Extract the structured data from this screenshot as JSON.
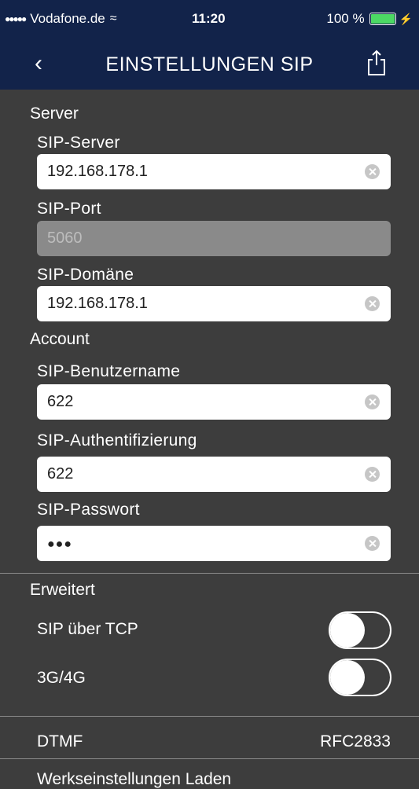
{
  "status_bar": {
    "carrier": "Vodafone.de",
    "time": "11:20",
    "battery": "100 %"
  },
  "nav": {
    "title": "EINSTELLUNGEN SIP"
  },
  "server": {
    "section": "Server",
    "sip_server_label": "SIP-Server",
    "sip_server_value": "192.168.178.1",
    "sip_port_label": "SIP-Port",
    "sip_port_value": "5060",
    "sip_domain_label": "SIP-Domäne",
    "sip_domain_value": "192.168.178.1"
  },
  "account": {
    "section": "Account",
    "username_label": "SIP-Benutzername",
    "username_value": "622",
    "auth_label": "SIP-Authentifizierung",
    "auth_value": "622",
    "password_label": "SIP-Passwort",
    "password_value": "●●●"
  },
  "advanced": {
    "section": "Erweitert",
    "sip_tcp_label": "SIP über TCP",
    "sip_tcp_on": false,
    "g34_label": "3G/4G",
    "g34_on": false
  },
  "dtmf": {
    "label": "DTMF",
    "value": "RFC2833"
  },
  "factory": {
    "label": "Werkseinstellungen Laden"
  },
  "colors": {
    "navbar": "#12234a",
    "background": "#3d3d3d",
    "battery": "#4cd964"
  }
}
